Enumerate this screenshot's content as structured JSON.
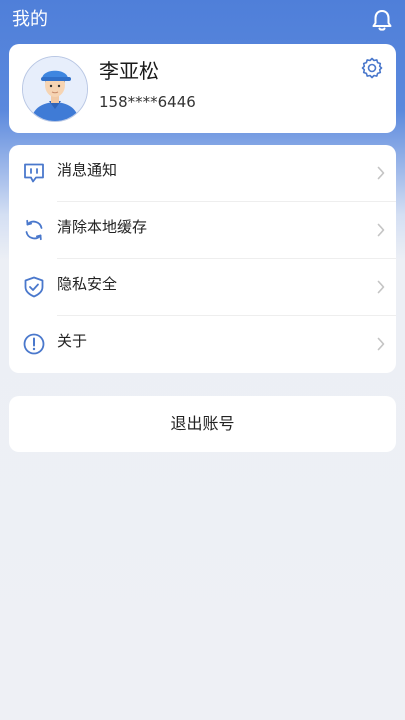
{
  "header": {
    "title": "我的",
    "bell_icon": "bell-icon"
  },
  "profile": {
    "name": "李亚松",
    "phone": "158****6446",
    "avatar": "worker-avatar",
    "settings_icon": "gear-icon"
  },
  "menu": {
    "items": [
      {
        "label": "消息通知",
        "icon": "message-icon"
      },
      {
        "label": "清除本地缓存",
        "icon": "refresh-icon"
      },
      {
        "label": "隐私安全",
        "icon": "shield-icon"
      },
      {
        "label": "关于",
        "icon": "info-icon"
      }
    ]
  },
  "logout": {
    "label": "退出账号"
  },
  "colors": {
    "header_blue": "#4f7fd9",
    "icon_blue": "#4a78cc",
    "page_bg": "#eef0f5"
  }
}
